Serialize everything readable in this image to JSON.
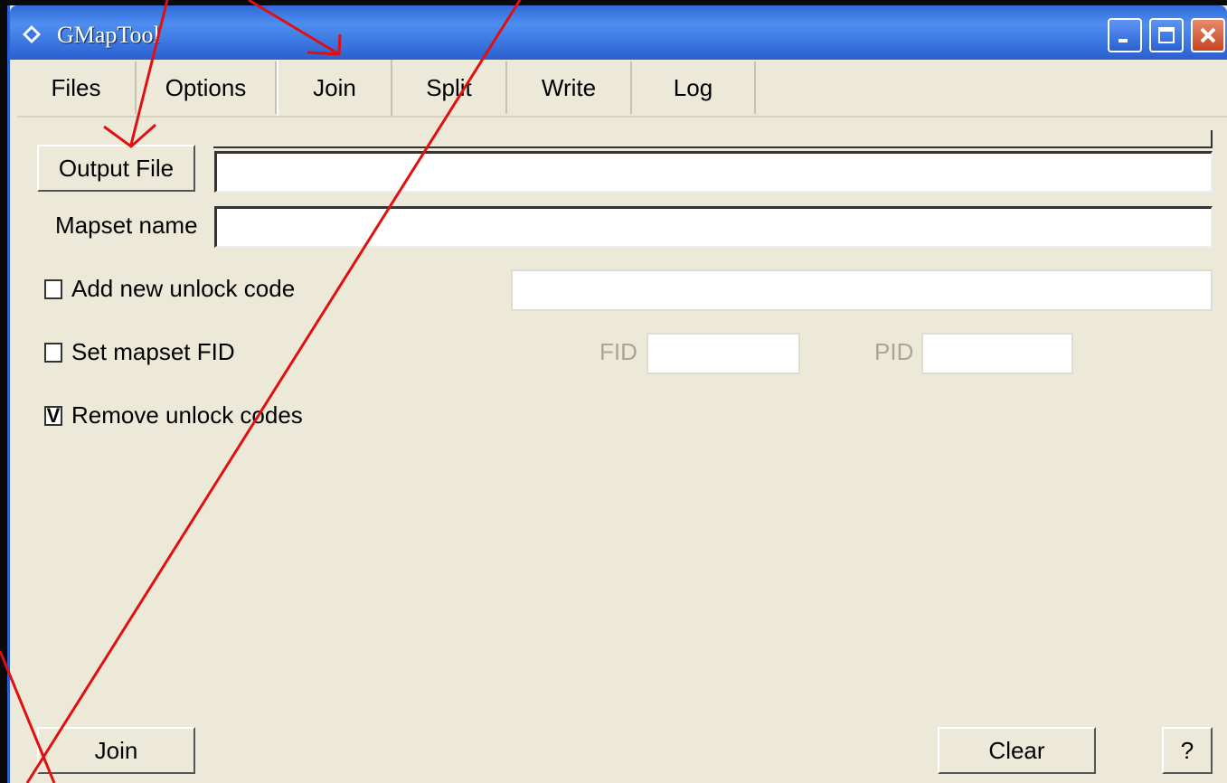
{
  "window": {
    "title": "GMapTool"
  },
  "tabs": [
    {
      "label": "Files"
    },
    {
      "label": "Options"
    },
    {
      "label": "Join"
    },
    {
      "label": "Split"
    },
    {
      "label": "Write"
    },
    {
      "label": "Log"
    }
  ],
  "active_tab": "Join",
  "join": {
    "output_file_button": "Output File",
    "output_file_value": "",
    "mapset_name_label": "Mapset name",
    "mapset_name_value": "",
    "add_unlock_label": "Add new unlock code",
    "add_unlock_checked": false,
    "unlock_code_value": "",
    "set_fid_label": "Set mapset FID",
    "set_fid_checked": false,
    "fid_label": "FID",
    "fid_value": "",
    "pid_label": "PID",
    "pid_value": "",
    "remove_unlock_label": "Remove unlock codes",
    "remove_unlock_checked": true,
    "remove_unlock_mark": "V"
  },
  "bottom": {
    "join_button": "Join",
    "clear_button": "Clear",
    "help_button": "?"
  },
  "colors": {
    "window_bg": "#ece9d8",
    "titlebar": "#2f6ad9",
    "annotation": "#e01010"
  }
}
